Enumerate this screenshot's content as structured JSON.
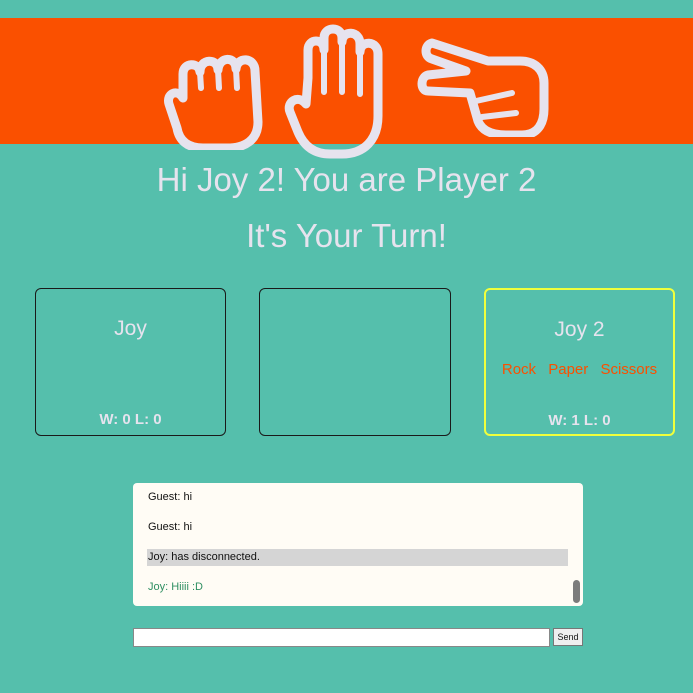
{
  "banner": {
    "icons": [
      "rock-hand-icon",
      "paper-hand-icon",
      "scissors-hand-icon"
    ],
    "color": "#fa5000"
  },
  "greeting": {
    "line1": "Hi Joy 2! You are Player 2",
    "line2": "It's Your Turn!"
  },
  "players": [
    {
      "name": "Joy",
      "score": "W: 0 L: 0"
    },
    {
      "name": "",
      "score": ""
    },
    {
      "name": "Joy 2",
      "score": "W: 1 L: 0",
      "choices": [
        "Rock",
        "Paper",
        "Scissors"
      ]
    }
  ],
  "chat": {
    "messages": [
      {
        "text": "Guest: hi",
        "type": "normal"
      },
      {
        "text": "Guest: hi",
        "type": "normal"
      },
      {
        "text": "Joy: has disconnected.",
        "type": "system"
      },
      {
        "text": "Joy: Hiiii :D",
        "type": "self"
      }
    ],
    "input_value": "",
    "send_label": "Send"
  },
  "colors": {
    "background": "#55bfac",
    "accent": "#fa5000",
    "active_border": "#f0ff3c",
    "text_light": "#e6e3ee",
    "self_message": "#2f8f62"
  }
}
